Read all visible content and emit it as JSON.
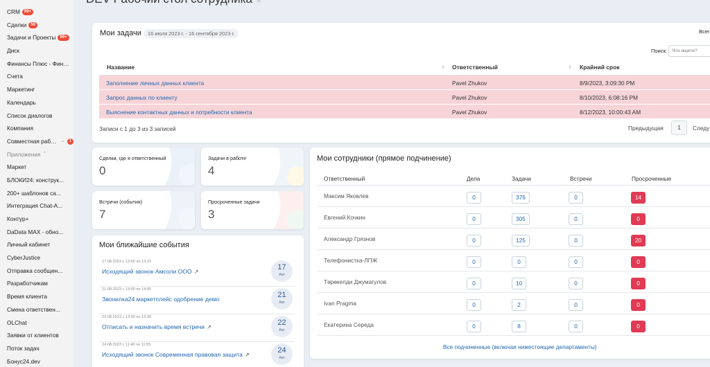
{
  "page": {
    "title_partial": "DEV Рабочий стол сотрудника"
  },
  "sidebar": {
    "items": [
      {
        "label": "CRM",
        "badge": "99+"
      },
      {
        "label": "Сделки",
        "badge": "59"
      },
      {
        "label": "Задачи и Проекты",
        "badge": "99+"
      },
      {
        "label": "Диск",
        "badge": ""
      },
      {
        "label": "Финансы Плюс - Фина...",
        "badge": ""
      },
      {
        "label": "Счета",
        "badge": ""
      },
      {
        "label": "Маркетинг",
        "badge": ""
      },
      {
        "label": "Календарь",
        "badge": ""
      },
      {
        "label": "Список диалогов",
        "badge": ""
      },
      {
        "label": "Компания",
        "badge": ""
      },
      {
        "label": "Совместная работа",
        "badge": "1"
      },
      {
        "label": "Приложения",
        "badge": ""
      },
      {
        "label": "Маркет",
        "badge": ""
      },
      {
        "label": "БЛОКИ24: конструк...",
        "badge": ""
      },
      {
        "label": "200+ шаблонов са...",
        "badge": ""
      },
      {
        "label": "Интеграция Chat-A...",
        "badge": ""
      },
      {
        "label": "Контур+",
        "badge": ""
      },
      {
        "label": "DaData MAX - обно...",
        "badge": ""
      },
      {
        "label": "Личный кабинет",
        "badge": ""
      },
      {
        "label": "CyberJustice",
        "badge": ""
      },
      {
        "label": "Отправка сообщен...",
        "badge": ""
      },
      {
        "label": "Разработчикам",
        "badge": ""
      },
      {
        "label": "Время клиента",
        "badge": ""
      },
      {
        "label": "Смена ответствен...",
        "badge": ""
      },
      {
        "label": "OLChat",
        "badge": ""
      },
      {
        "label": "Заявки от клиентов",
        "badge": ""
      },
      {
        "label": "Поток задач",
        "badge": ""
      },
      {
        "label": "Бонус24.dev",
        "badge": ""
      }
    ]
  },
  "tasks": {
    "title": "Мои задачи",
    "date_range": "16 июля 2023 г. - 16 сентября 2023 г.",
    "total_label": "Всего",
    "search_label": "Поиск:",
    "search_placeholder": "Что ищете?",
    "columns": [
      "Название",
      "Ответственный",
      "Крайний срок"
    ],
    "rows": [
      {
        "name": "Заполнение личных данных клиента",
        "responsible": "Pavel Zhukov",
        "deadline": "8/9/2023, 3:09:30 PM"
      },
      {
        "name": "Запрос данных по клиенту",
        "responsible": "Pavel Zhukov",
        "deadline": "8/10/2023, 6:08:16 PM"
      },
      {
        "name": "Выяснение контактных данных и потребности клиента",
        "responsible": "Pavel Zhukov",
        "deadline": "8/12/2023, 10:00:43 AM"
      }
    ],
    "records_info": "Записи с 1 до 3 из 3 записей",
    "prev_label": "Предыдущая",
    "page": "1",
    "next_label": "Следу"
  },
  "stats": {
    "deals": {
      "title": "Сделки, где я ответственный",
      "value": "0"
    },
    "tasks_in_work": {
      "title": "Задачи в работе",
      "value": "4"
    },
    "meetings": {
      "title": "Встречи (события)",
      "value": "7"
    },
    "overdue": {
      "title": "Просроченные задачи",
      "value": "3"
    }
  },
  "events": {
    "title": "Мои ближайшие события",
    "items": [
      {
        "time": "17.08.2023 с 13:00 по 13:15",
        "title": "Исходящий звонок Амсоли ООО",
        "ext": true,
        "day": "17",
        "month": "Авг"
      },
      {
        "time": "21.08.2023 с 13:00 по 14:00",
        "title": "Звонилка24 маркетплейс одобрение демо",
        "ext": false,
        "day": "21",
        "month": "Авг"
      },
      {
        "time": "22.08.2023 с 13:00 по 13:30",
        "title": "Отписать и назначить время встречи",
        "ext": true,
        "day": "22",
        "month": "Авг"
      },
      {
        "time": "24.08.2023 с 11:40 по 11:55",
        "title": "Исходящий звонок Современная правовая защита",
        "ext": true,
        "day": "24",
        "month": "Авг"
      }
    ]
  },
  "employees": {
    "title": "Мои сотрудники (прямое подчинение)",
    "columns": [
      "Ответственный",
      "Дела",
      "Задачи",
      "Встречи",
      "Просроченные"
    ],
    "rows": [
      {
        "name": "Максим Яковлев",
        "deals": "0",
        "tasks": "376",
        "meetings": "0",
        "overdue": "14"
      },
      {
        "name": "Евгений Кочкин",
        "deals": "0",
        "tasks": "305",
        "meetings": "0",
        "overdue": "0"
      },
      {
        "name": "Александр Грязнов",
        "deals": "0",
        "tasks": "125",
        "meetings": "0",
        "overdue": "20"
      },
      {
        "name": "Телефонистка-ЛПЖ",
        "deals": "0",
        "tasks": "0",
        "meetings": "0",
        "overdue": "0"
      },
      {
        "name": "Төрөкелди Джумагулов",
        "deals": "0",
        "tasks": "10",
        "meetings": "0",
        "overdue": "0"
      },
      {
        "name": "Ivan Pragma",
        "deals": "0",
        "tasks": "2",
        "meetings": "0",
        "overdue": "0"
      },
      {
        "name": "Екатерина Середа",
        "deals": "0",
        "tasks": "8",
        "meetings": "0",
        "overdue": "0"
      }
    ],
    "all_link": "Все подчиненные (включая нижестоящие департаменты)"
  },
  "colors": {
    "accent": "#2067b0",
    "overdue_row": "#f7d4d8",
    "danger": "#e03a54",
    "badge": "#ef4b36"
  }
}
